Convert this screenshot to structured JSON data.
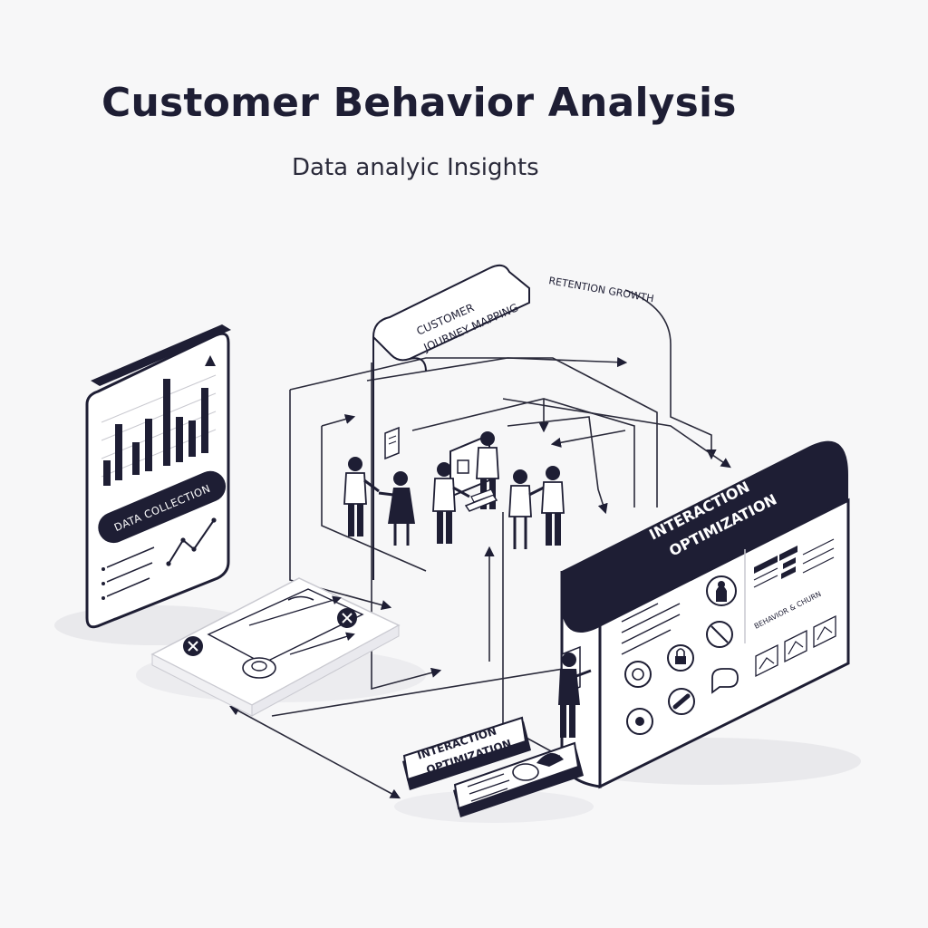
{
  "header": {
    "title": "Customer Behavior Analysis",
    "subtitle": "Data analyic Insights"
  },
  "labels": {
    "data_collection": "DATA COLLECTION",
    "journey_mapping_line1": "CUSTOMER",
    "journey_mapping_line2": "JOURNEY MAPPING",
    "retention_growth": "RETENTION GROWTH",
    "interaction_optimization_line1": "INTERACTION",
    "interaction_optimization_line2": "OPTIMIZATION",
    "small_card_line1": "INTERACTION",
    "small_card_line2": "OPTIMIZATION",
    "panel_section": "BEHAVIOR & CHURN"
  },
  "colors": {
    "navy": "#1e1e34",
    "background": "#f7f7f8",
    "card": "#ffffff",
    "line": "#2a2a3a"
  }
}
